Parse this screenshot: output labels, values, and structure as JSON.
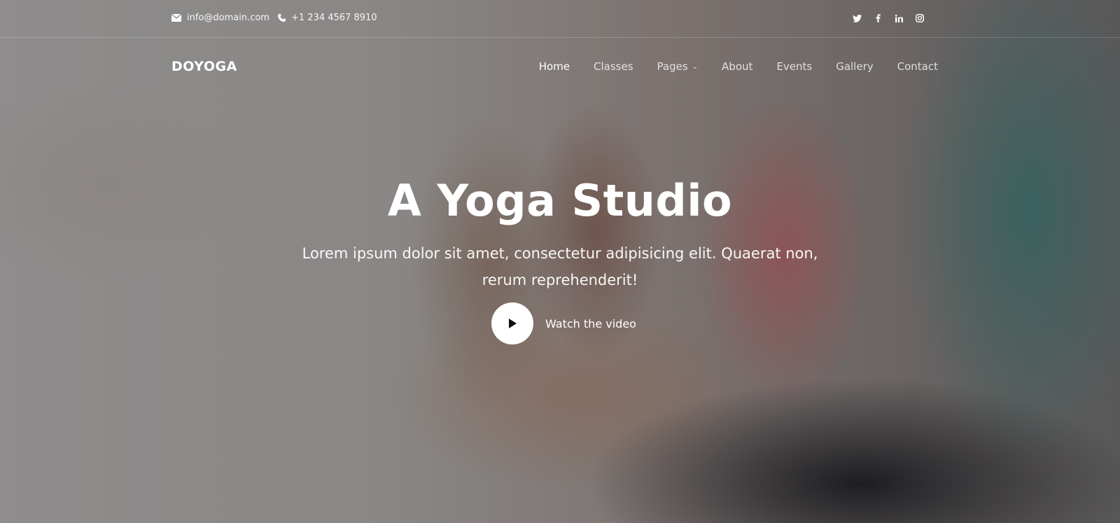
{
  "topbar": {
    "email": "info@domain.com",
    "phone": "+1 234 4567 8910",
    "social_icons": [
      "twitter-icon",
      "facebook-icon",
      "linkedin-icon",
      "instagram-icon"
    ]
  },
  "nav": {
    "logo": "DOYOGA",
    "items": [
      {
        "label": "Home",
        "active": true
      },
      {
        "label": "Classes"
      },
      {
        "label": "Pages",
        "has_dropdown": true
      },
      {
        "label": "About"
      },
      {
        "label": "Events"
      },
      {
        "label": "Gallery"
      },
      {
        "label": "Contact"
      }
    ]
  },
  "hero": {
    "title": "A Yoga Studio",
    "subtitle": "Lorem ipsum dolor sit amet, consectetur adipisicing elit. Quaerat non, rerum reprehenderit!",
    "video_label": "Watch the video"
  },
  "colors": {
    "text": "#ffffff",
    "play_button": "#ffffff",
    "play_icon": "#111111"
  }
}
